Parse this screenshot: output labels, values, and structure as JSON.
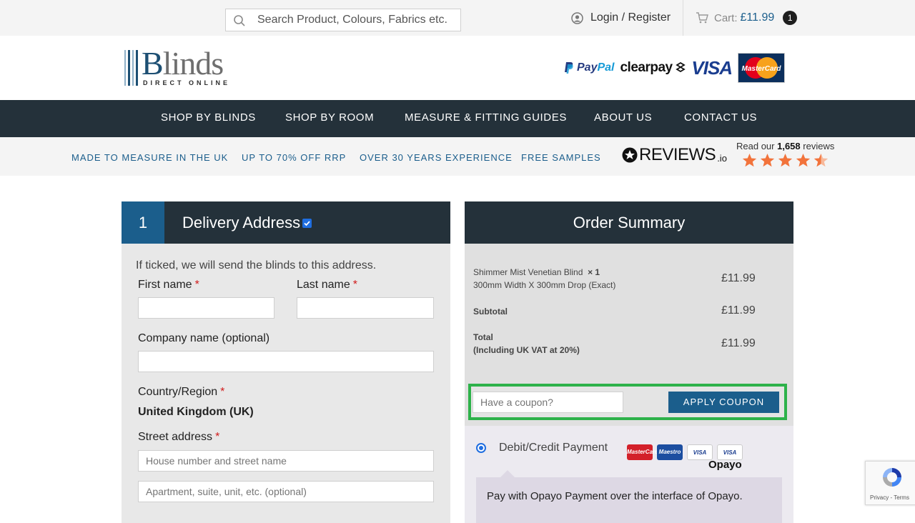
{
  "topbar": {
    "search_placeholder": "Search Product, Colours, Fabrics etc.",
    "login_label": "Login / Register",
    "cart_label": "Cart:",
    "cart_amount": "£11.99",
    "cart_count": "1"
  },
  "logo": {
    "word_first": "B",
    "word_rest": "linds",
    "subtitle": "DIRECT ONLINE"
  },
  "payment_logos": {
    "paypal_a": "Pay",
    "paypal_b": "Pal",
    "clearpay": "clearpay",
    "visa": "VISA",
    "mastercard": "MasterCard"
  },
  "nav": {
    "items": [
      "SHOP BY BLINDS",
      "SHOP BY ROOM",
      "MEASURE & FITTING GUIDES",
      "ABOUT US",
      "CONTACT US"
    ]
  },
  "usp": {
    "items": [
      "MADE TO MEASURE IN THE UK",
      "UP TO 70% OFF RRP",
      "OVER 30 YEARS EXPERIENCE",
      "FREE SAMPLES"
    ],
    "reviews_logo": "REVIEWS",
    "reviews_logo_suffix": ".io",
    "reviews_prefix": "Read our",
    "reviews_count": "1,658",
    "reviews_suffix": "reviews",
    "rating": 4.5,
    "star_color": "#f2733b"
  },
  "delivery": {
    "step": "1",
    "title": "Delivery Address",
    "checked": true,
    "note": "If ticked, we will send the blinds to this address.",
    "first_name_label": "First name",
    "last_name_label": "Last name",
    "company_label": "Company name (optional)",
    "country_label": "Country/Region",
    "country_value": "United Kingdom (UK)",
    "street_label": "Street address",
    "street_placeholder": "House number and street name",
    "street2_placeholder": "Apartment, suite, unit, etc. (optional)",
    "required_mark": "*"
  },
  "summary": {
    "title": "Order Summary",
    "item_name": "Shimmer Mist Venetian Blind",
    "item_qty": "× 1",
    "item_detail": "300mm Width X 300mm Drop (Exact)",
    "item_price": "£11.99",
    "subtotal_label": "Subtotal",
    "subtotal_value": "£11.99",
    "total_label": "Total",
    "total_note": "(Including UK VAT at 20%)",
    "total_value": "£11.99",
    "coupon_placeholder": "Have a coupon?",
    "coupon_button": "APPLY COUPON",
    "payment_label": "Debit/Credit Payment",
    "payment_provider": "Opayo",
    "payment_desc": "Pay with Opayo Payment over the interface of Opayo.",
    "cards": [
      "MasterCard",
      "Maestro",
      "VISA",
      "VISA"
    ]
  },
  "recaptcha": {
    "footer": "Privacy - Terms"
  },
  "colors": {
    "brand_blue": "#1b5e8c",
    "nav_dark": "#24313a",
    "highlight_green": "#2db24a"
  }
}
